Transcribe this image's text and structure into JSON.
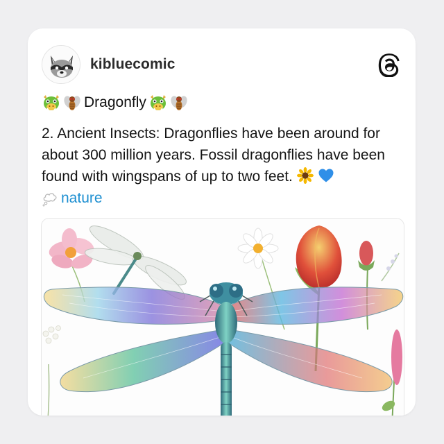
{
  "post": {
    "username": "kibluecomic",
    "title": "Dragonfly",
    "body": "2. Ancient Insects: Dragonflies have been around for about 300 million years. Fossil dragonflies have been found with wingspans of up to two feet.",
    "tag": "nature"
  },
  "icons": {
    "avatar": "raccoon-avatar",
    "logo": "threads-logo",
    "title_emojis": [
      "dragon-face-icon",
      "fly-icon",
      "dragon-face-icon",
      "fly-icon"
    ],
    "body_emojis": [
      "sunflower-icon",
      "blue-heart-icon"
    ],
    "tag_emoji": "thought-bubble-icon"
  },
  "colors": {
    "tag": "#1d8fd1",
    "card": "#ffffff",
    "background": "#efeff1"
  }
}
